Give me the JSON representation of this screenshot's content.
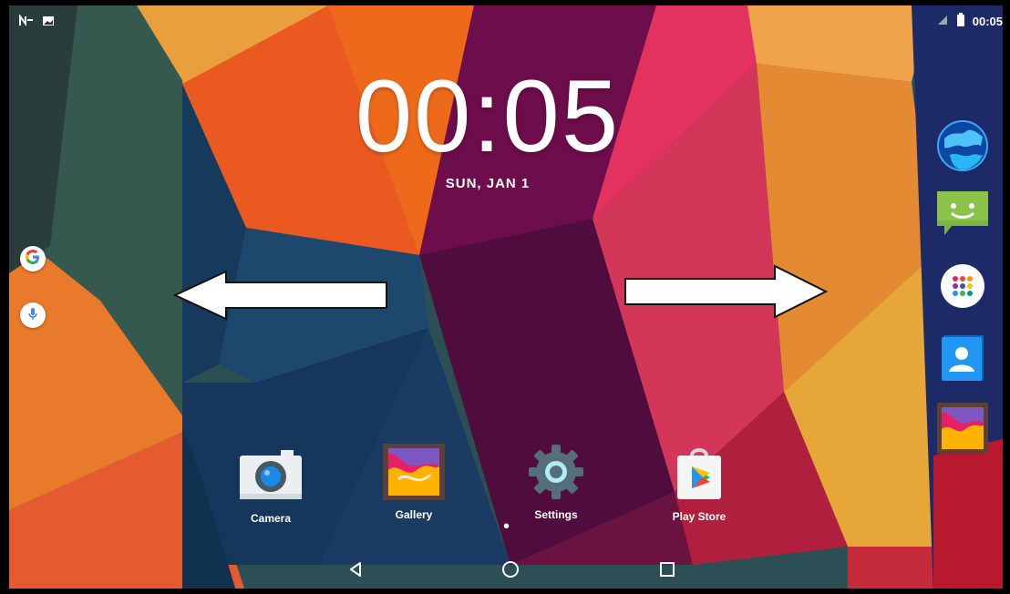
{
  "status_bar": {
    "time": "00:05",
    "left_icons": [
      "n-icon",
      "image-icon"
    ],
    "right_icons": [
      "signal-icon",
      "battery-icon"
    ]
  },
  "lockscreen": {
    "time": "00:05",
    "date": "SUN, JAN 1"
  },
  "edge_shortcuts": [
    {
      "name": "google-search",
      "icon": "google-icon"
    },
    {
      "name": "voice-search",
      "icon": "mic-icon"
    }
  ],
  "dock": {
    "apps": [
      {
        "label": "Camera",
        "icon": "camera-icon"
      },
      {
        "label": "Gallery",
        "icon": "gallery-icon"
      },
      {
        "label": "Settings",
        "icon": "settings-icon"
      },
      {
        "label": "Play Store",
        "icon": "play-store-icon"
      }
    ],
    "page_indicator": "•"
  },
  "right_rail": [
    {
      "name": "browser",
      "icon": "globe-icon"
    },
    {
      "name": "messaging",
      "icon": "message-icon"
    },
    {
      "name": "apps",
      "icon": "apps-icon"
    },
    {
      "name": "contacts",
      "icon": "contacts-icon"
    },
    {
      "name": "gallery",
      "icon": "gallery-icon"
    }
  ],
  "nav_bar": {
    "back_icon": "back-icon",
    "home_icon": "home-icon",
    "recents_icon": "recents-icon"
  },
  "arrows": {
    "left": "left-arrow",
    "right": "right-arrow"
  },
  "colors": {
    "frame": "#000000",
    "text": "#ffffff"
  }
}
